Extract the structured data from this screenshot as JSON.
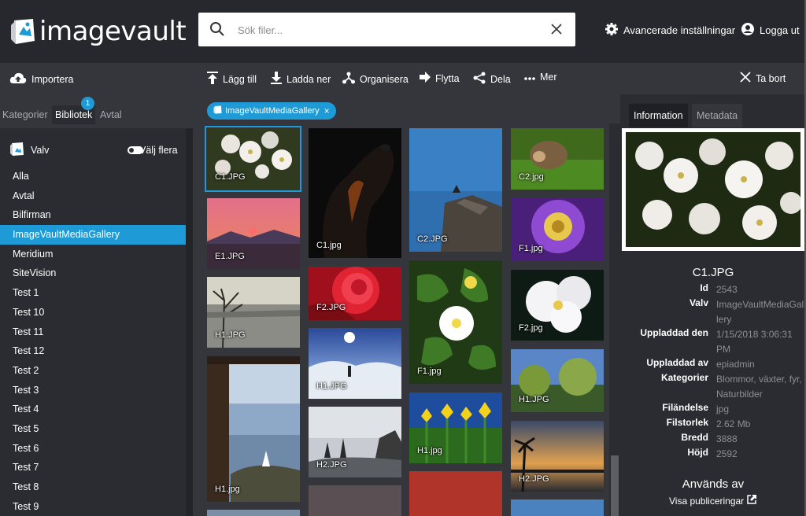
{
  "app": {
    "logo_text": "imagevault"
  },
  "search": {
    "placeholder": "Sök filer..."
  },
  "header": {
    "settings_label": "Avancerade inställningar",
    "logout_label": "Logga ut"
  },
  "toolbar": {
    "import_label": "Importera",
    "add_label": "Lägg till",
    "download_label": "Ladda ner",
    "organize_label": "Organisera",
    "move_label": "Flytta",
    "share_label": "Dela",
    "more_label": "Mer",
    "delete_label": "Ta bort"
  },
  "sidebar": {
    "tabs": [
      {
        "label": "Kategorier"
      },
      {
        "label": "Bibliotek"
      },
      {
        "label": "Avtal"
      }
    ],
    "badge_count": "1",
    "vault_label": "Valv",
    "multi_select_label": "Välj flera",
    "items": [
      {
        "label": "Alla"
      },
      {
        "label": "Avtal"
      },
      {
        "label": "Bilfirman"
      },
      {
        "label": "ImageVaultMediaGallery"
      },
      {
        "label": "Meridium"
      },
      {
        "label": "SiteVision"
      },
      {
        "label": "Test 1"
      },
      {
        "label": "Test 10"
      },
      {
        "label": "Test 11"
      },
      {
        "label": "Test 12"
      },
      {
        "label": "Test 2"
      },
      {
        "label": "Test 3"
      },
      {
        "label": "Test 4"
      },
      {
        "label": "Test 5"
      },
      {
        "label": "Test 6"
      },
      {
        "label": "Test 7"
      },
      {
        "label": "Test 8"
      },
      {
        "label": "Test 9"
      }
    ],
    "active_index": 3
  },
  "gallery": {
    "filter_chip": "ImageVaultMediaGallery",
    "thumbs": [
      {
        "label": "C1.JPG"
      },
      {
        "label": "E1.JPG"
      },
      {
        "label": "H1.JPG"
      },
      {
        "label": "H1.jpg"
      },
      {
        "label": "C1.jpg"
      },
      {
        "label": "F2.JPG"
      },
      {
        "label": "H1.JPG"
      },
      {
        "label": "H2.JPG"
      },
      {
        "label": "C2.JPG"
      },
      {
        "label": "F1.jpg"
      },
      {
        "label": "H1.jpg"
      },
      {
        "label": "C2.jpg"
      },
      {
        "label": "F1.jpg"
      },
      {
        "label": "F2.jpg"
      },
      {
        "label": "H1.JPG"
      },
      {
        "label": "H2.JPG"
      }
    ]
  },
  "info": {
    "tabs": [
      {
        "label": "Information"
      },
      {
        "label": "Metadata"
      }
    ],
    "title": "C1.JPG",
    "fields": [
      {
        "key": "Id",
        "value": "2543"
      },
      {
        "key": "Valv",
        "value": "ImageVaultMediaGallery"
      },
      {
        "key": "Uppladdad den",
        "value": "1/15/2018 3:06:31 PM"
      },
      {
        "key": "Uppladdad av",
        "value": "epiadmin"
      },
      {
        "key": "Kategorier",
        "value": "Blommor, växter, fyr, Naturbilder"
      },
      {
        "key": "Filändelse",
        "value": "jpg"
      },
      {
        "key": "Filstorlek",
        "value": "2.62 Mb"
      },
      {
        "key": "Bredd",
        "value": "3888"
      },
      {
        "key": "Höjd",
        "value": "2592"
      }
    ],
    "used_by_title": "Används av",
    "show_publications_label": "Visa publiceringar"
  },
  "colors": {
    "accent": "#1e9bd7",
    "topbar": "#27282d",
    "toolbar": "#35363b",
    "panel": "#2b2c31"
  }
}
